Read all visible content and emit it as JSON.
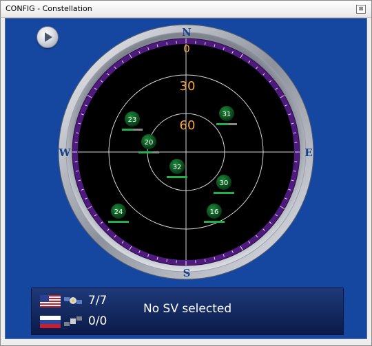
{
  "window": {
    "title": "CONFIG - Constellation",
    "close_glyph": "⊠"
  },
  "compass": {
    "north": "N",
    "south": "S",
    "east": "E",
    "west": "W",
    "elevations": [
      "0",
      "30",
      "60"
    ]
  },
  "satellites": [
    {
      "id": "23",
      "signal": 0.55
    },
    {
      "id": "31",
      "signal": 0.6
    },
    {
      "id": "20",
      "signal": 0.65
    },
    {
      "id": "32",
      "signal": 1.0
    },
    {
      "id": "30",
      "signal": 1.0
    },
    {
      "id": "24",
      "signal": 1.0
    },
    {
      "id": "16",
      "signal": 1.0
    }
  ],
  "status": {
    "gps_count": "7/7",
    "glonass_count": "0/0",
    "message": "No SV selected"
  },
  "colors": {
    "background": "#1547a0",
    "satellite": "#0b5a1f",
    "signal_bar": "#22b04a",
    "elevation_text": "#f5a640",
    "bezel_ring": "#5b1f8a"
  }
}
